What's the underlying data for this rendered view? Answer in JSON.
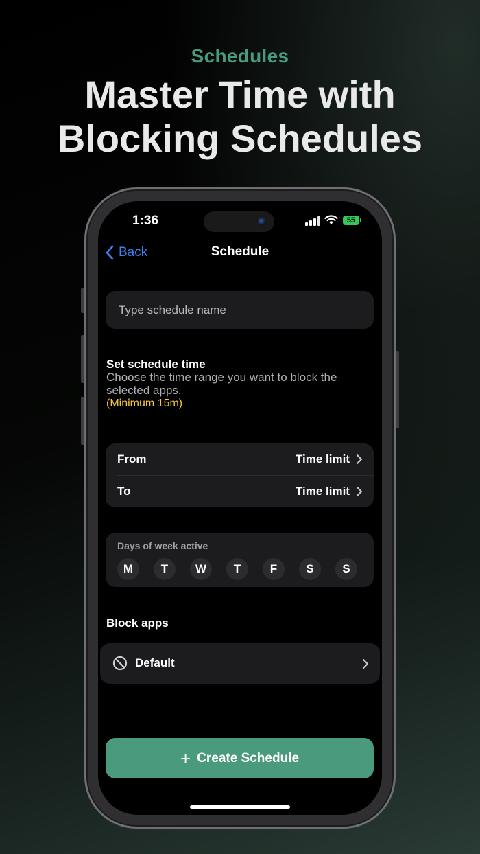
{
  "promo": {
    "kicker": "Schedules",
    "headline_line1": "Master Time with",
    "headline_line2": "Blocking Schedules"
  },
  "status_bar": {
    "time": "1:36",
    "battery": "55"
  },
  "nav": {
    "back_label": "Back",
    "title": "Schedule"
  },
  "name_field": {
    "placeholder": "Type schedule name",
    "value": ""
  },
  "schedule_time": {
    "title": "Set schedule time",
    "description": "Choose the time range you want to block the selected apps.",
    "minimum": "(Minimum 15m)",
    "from_label": "From",
    "from_value": "Time limit",
    "to_label": "To",
    "to_value": "Time limit"
  },
  "days": {
    "label": "Days of week active",
    "items": [
      "M",
      "T",
      "W",
      "T",
      "F",
      "S",
      "S"
    ]
  },
  "block_apps": {
    "title": "Block apps",
    "selection": "Default"
  },
  "create_button": {
    "label": "Create Schedule"
  },
  "colors": {
    "accent": "#4a9a7e",
    "link": "#3b82f6",
    "warning": "#f5c542",
    "battery": "#34c759"
  }
}
